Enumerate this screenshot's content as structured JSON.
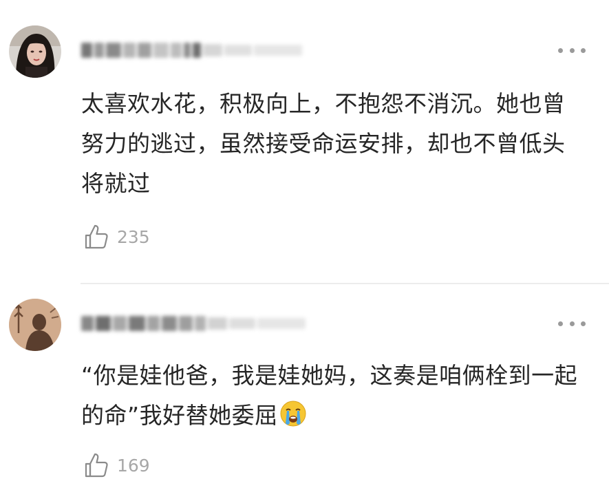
{
  "comments": [
    {
      "text": "太喜欢水花，积极向上，不抱怨不消沉。她也曾努力的逃过，虽然接受命运安排，却也不曾低头将就过",
      "likes": "235",
      "avatar_icon": "avatar-woman-photo",
      "menu_icon": "more-dots-icon",
      "like_icon": "thumbs-up-icon"
    },
    {
      "text": "“你是娃他爸，我是娃她妈，这奏是咱俩栓到一起的命”我好替她委屈",
      "emoji": "crying-face-emoji",
      "likes": "169",
      "avatar_icon": "avatar-silhouette-photo",
      "menu_icon": "more-dots-icon",
      "like_icon": "thumbs-up-icon"
    }
  ],
  "colors": {
    "text": "#262626",
    "muted": "#a7a7a7",
    "divider": "#ececec",
    "dots": "#9a9a9a"
  }
}
